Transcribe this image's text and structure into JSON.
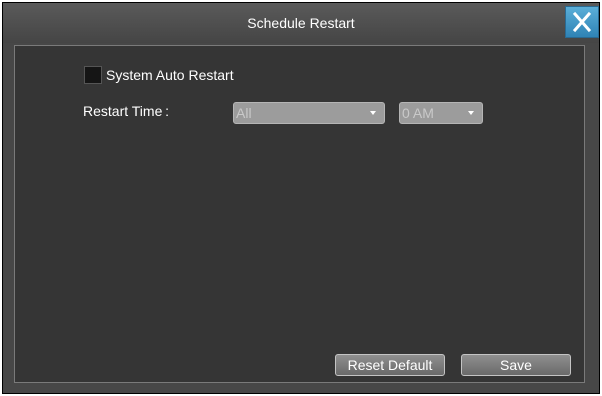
{
  "window": {
    "title": "Schedule Restart"
  },
  "auto_restart": {
    "label": "System Auto Restart",
    "checked": false
  },
  "restart_time": {
    "label": "Restart Time :",
    "day_value": "All",
    "hour_value": "0 AM"
  },
  "buttons": {
    "reset_label": "Reset Default",
    "save_label": "Save"
  },
  "icons": {
    "close": "close-icon",
    "dropdown": "chevron-down-icon"
  },
  "colors": {
    "accent": "#3d94c6",
    "background": "#353535",
    "titlebar": "#4f4f4f"
  }
}
